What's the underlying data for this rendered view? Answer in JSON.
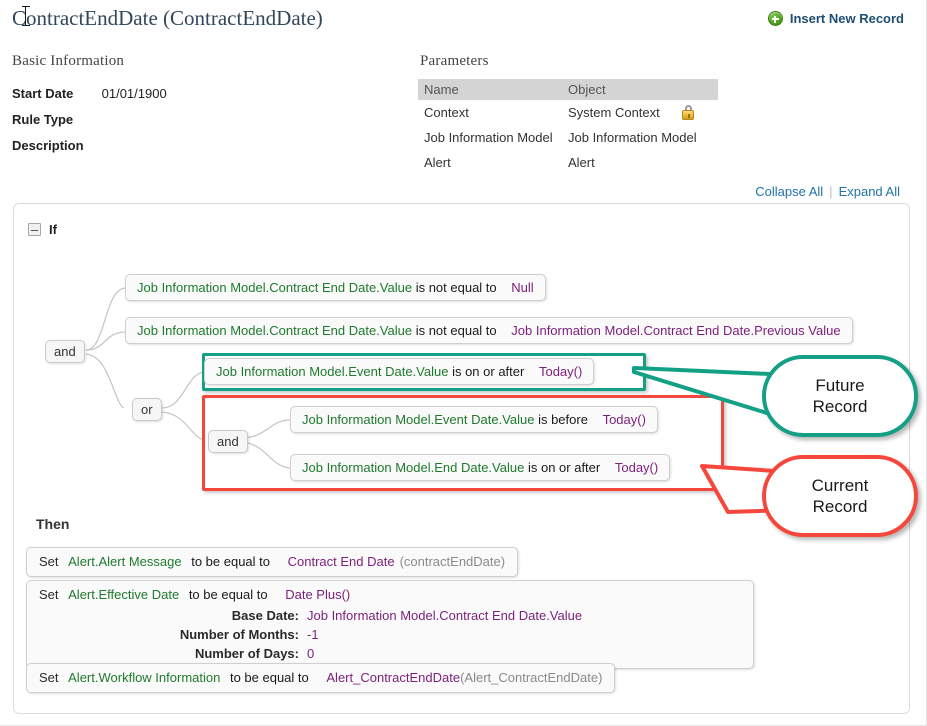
{
  "header": {
    "title": "ContractEndDate (ContractEndDate)",
    "insert_new_record": "Insert New Record",
    "insert_icon": "circle-plus-icon"
  },
  "basic_information": {
    "heading": "Basic Information",
    "rows": [
      {
        "label": "Start Date",
        "value": "01/01/1900"
      },
      {
        "label": "Rule Type",
        "value": ""
      },
      {
        "label": "Description",
        "value": ""
      }
    ]
  },
  "parameters": {
    "heading": "Parameters",
    "columns": [
      "Name",
      "Object"
    ],
    "rows": [
      {
        "name": "Context",
        "object": "System Context",
        "locked": true,
        "lock_icon": "padlock-icon"
      },
      {
        "name": "Job Information Model",
        "object": "Job Information Model",
        "locked": false
      },
      {
        "name": "Alert",
        "object": "Alert",
        "locked": false
      }
    ]
  },
  "toolbar": {
    "collapse_all": "Collapse All",
    "expand_all": "Expand All",
    "separator": "|"
  },
  "rule": {
    "if_label": "If",
    "then_label": "Then",
    "operators": {
      "root_and": "and",
      "or": "or",
      "inner_and": "and"
    },
    "conditions": [
      {
        "field": "Job Information Model.Contract End Date.Value",
        "operator": "is not equal to",
        "value": "Null"
      },
      {
        "field": "Job Information Model.Contract End Date.Value",
        "operator": "is not equal to",
        "value": "Job Information Model.Contract End Date.Previous Value"
      },
      {
        "field": "Job Information Model.Event Date.Value",
        "operator": "is on or after",
        "value": "Today()"
      },
      {
        "field": "Job Information Model.Event Date.Value",
        "operator": "is before",
        "value": "Today()"
      },
      {
        "field": "Job Information Model.End Date.Value",
        "operator": "is on or after",
        "value": "Today()"
      }
    ],
    "actions": [
      {
        "set": "Set",
        "target": "Alert.Alert Message",
        "equals": "to be equal to",
        "value": "Contract End Date",
        "value_suffix": "(contractEndDate)"
      },
      {
        "set": "Set",
        "target": "Alert.Effective Date",
        "equals": "to be equal to",
        "value": "Date Plus()",
        "value_suffix": "",
        "params": [
          {
            "key": "Base Date:",
            "value": "Job Information Model.Contract End Date.Value"
          },
          {
            "key": "Number of Months:",
            "value": "-1"
          },
          {
            "key": "Number of Days:",
            "value": "0"
          }
        ]
      },
      {
        "set": "Set",
        "target": "Alert.Workflow Information",
        "equals": "to be equal to",
        "value": "Alert_ContractEndDate",
        "value_suffix": "(Alert_ContractEndDate)"
      }
    ]
  },
  "annotations": [
    {
      "text": "Future\nRecord",
      "line1": "Future",
      "line2": "Record",
      "color": "#13a085"
    },
    {
      "text": "Current\nRecord",
      "line1": "Current",
      "line2": "Record",
      "color": "#f5473c"
    }
  ],
  "colors": {
    "field_green": "#1f7a2e",
    "value_purple": "#7b1f7b",
    "link_blue": "#2173a8",
    "title_blue": "#33475b",
    "highlight_teal": "#13a085",
    "highlight_red": "#f5473c"
  }
}
